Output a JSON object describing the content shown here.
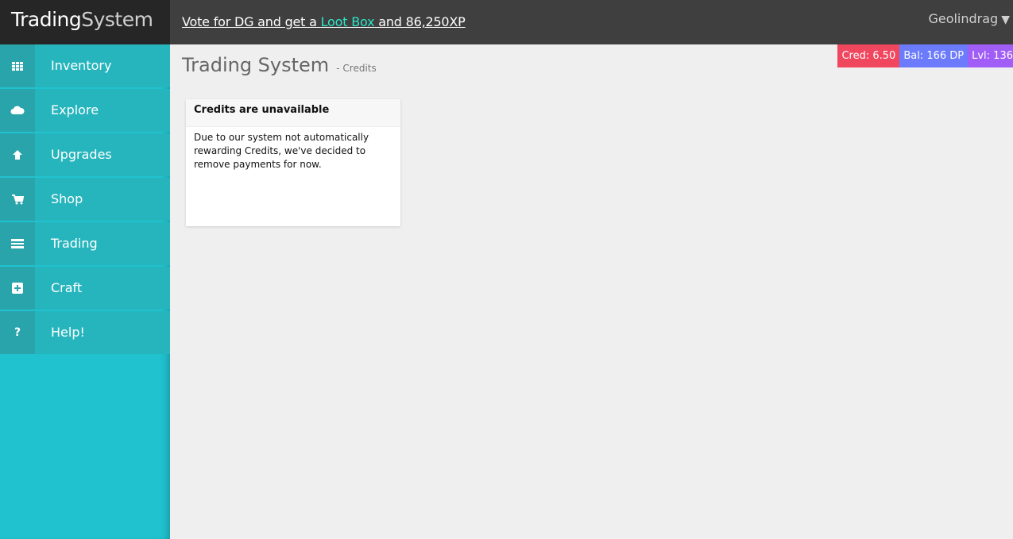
{
  "header": {
    "brand_part1": "Trading",
    "brand_part2": "System",
    "promo_prefix": "Vote for DG and get a ",
    "promo_link": "Loot Box",
    "promo_suffix": " and 86,250XP",
    "username": "Geolindrag",
    "caret": "▼"
  },
  "sidebar": {
    "items": [
      {
        "label": "Inventory",
        "icon": "grid-icon"
      },
      {
        "label": "Explore",
        "icon": "cloud-icon"
      },
      {
        "label": "Upgrades",
        "icon": "arrow-up-icon"
      },
      {
        "label": "Shop",
        "icon": "cart-icon"
      },
      {
        "label": "Trading",
        "icon": "list-icon"
      },
      {
        "label": "Craft",
        "icon": "plus-square-icon"
      },
      {
        "label": "Help!",
        "icon": "question-icon"
      }
    ]
  },
  "page": {
    "title": "Trading System",
    "subtitle": "- Credits"
  },
  "stats": {
    "credits": "Cred: 6.50",
    "balance": "Bal: 166 DP",
    "level": "Lvl: 136"
  },
  "card": {
    "title": "Credits are unavailable",
    "body": "Due to our system not automatically rewarding Credits, we've decided to remove payments for now."
  },
  "colors": {
    "sidebar": "#20c2cf",
    "topbar": "#3f3f3f",
    "brand_bg": "#262626",
    "loot_link": "#2ee6c9",
    "credits_badge": "#f0475f",
    "balance_badge": "#6c7bfb",
    "level_badge": "#a15ef7"
  }
}
